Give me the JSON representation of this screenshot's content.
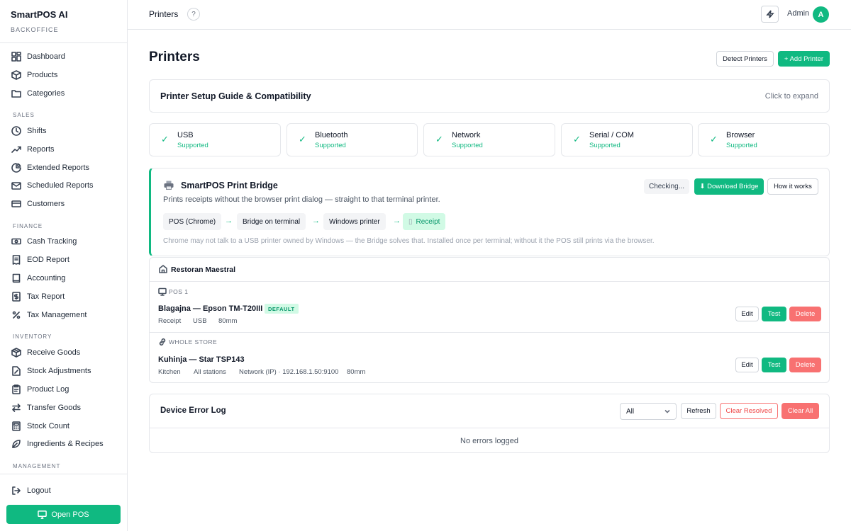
{
  "app": {
    "brand": "SmartPOS AI",
    "brand_sub": "BACKOFFICE"
  },
  "sidebar": {
    "top_items": [
      {
        "label": "Dashboard",
        "icon": "dashboard-icon"
      },
      {
        "label": "Products",
        "icon": "box-icon"
      },
      {
        "label": "Categories",
        "icon": "folder-icon"
      }
    ],
    "sections": [
      {
        "title": "SALES",
        "items": [
          {
            "label": "Shifts",
            "icon": "clock-icon"
          },
          {
            "label": "Reports",
            "icon": "trend-icon"
          },
          {
            "label": "Extended Reports",
            "icon": "pie-icon"
          },
          {
            "label": "Scheduled Reports",
            "icon": "mail-icon"
          },
          {
            "label": "Customers",
            "icon": "card-icon"
          }
        ]
      },
      {
        "title": "FINANCE",
        "items": [
          {
            "label": "Cash Tracking",
            "icon": "cash-icon"
          },
          {
            "label": "EOD Report",
            "icon": "receipt-icon"
          },
          {
            "label": "Accounting",
            "icon": "book-icon"
          },
          {
            "label": "Tax Report",
            "icon": "dollar-icon"
          },
          {
            "label": "Tax Management",
            "icon": "percent-icon"
          }
        ]
      },
      {
        "title": "INVENTORY",
        "items": [
          {
            "label": "Receive Goods",
            "icon": "package-icon"
          },
          {
            "label": "Stock Adjustments",
            "icon": "file-edit-icon"
          },
          {
            "label": "Product Log",
            "icon": "clipboard-icon"
          },
          {
            "label": "Transfer Goods",
            "icon": "transfer-icon"
          },
          {
            "label": "Stock Count",
            "icon": "calculator-icon"
          },
          {
            "label": "Ingredients & Recipes",
            "icon": "leaf-icon"
          }
        ]
      },
      {
        "title": "MANAGEMENT",
        "items": []
      }
    ],
    "logout": "Logout",
    "open_pos": "Open POS"
  },
  "topbar": {
    "title": "Printers",
    "help": "?",
    "user": "Admin",
    "avatar": "A"
  },
  "page": {
    "title": "Printers",
    "detect_button": "Detect Printers",
    "add_button": "+ Add Printer"
  },
  "guide": {
    "title": "Printer Setup Guide & Compatibility",
    "expand": "Click to expand"
  },
  "capabilities": [
    {
      "name": "USB",
      "status": "Supported"
    },
    {
      "name": "Bluetooth",
      "status": "Supported"
    },
    {
      "name": "Network",
      "status": "Supported"
    },
    {
      "name": "Serial / COM",
      "status": "Supported"
    },
    {
      "name": "Browser",
      "status": "Supported"
    }
  ],
  "bridge": {
    "title": "SmartPOS Print Bridge",
    "description": "Prints receipts without the browser print dialog — straight to that terminal printer.",
    "checking": "Checking...",
    "download": "⬇ Download Bridge",
    "how": "How it works",
    "flow": [
      "POS (Chrome)",
      "Bridge on terminal",
      "Windows printer",
      "Receipt"
    ],
    "arrow": "→",
    "note": "Chrome may not talk to a USB printer owned by Windows — the Bridge solves that. Installed once per terminal; without it the POS still prints via the browser."
  },
  "store": {
    "name": "Restoran Maestral",
    "groups": [
      {
        "label": "POS 1",
        "printer": {
          "name": "Blagajna — Epson TM-T20III",
          "badge": "DEFAULT",
          "meta": [
            "Receipt",
            "USB",
            "80mm"
          ]
        }
      },
      {
        "label": "WHOLE STORE",
        "printer": {
          "name": "Kuhinja — Star TSP143",
          "meta": [
            "Kitchen",
            "All stations",
            "Network (IP) · 192.168.1.50:9100",
            "80mm"
          ]
        }
      }
    ],
    "actions": {
      "edit": "Edit",
      "test": "Test",
      "delete": "Delete"
    }
  },
  "error_log": {
    "title": "Device Error Log",
    "filter": "All",
    "refresh": "Refresh",
    "clear_resolved": "Clear Resolved",
    "clear_all": "Clear All",
    "empty": "No errors logged"
  },
  "colors": {
    "accent": "#10b981",
    "danger": "#f87171"
  }
}
